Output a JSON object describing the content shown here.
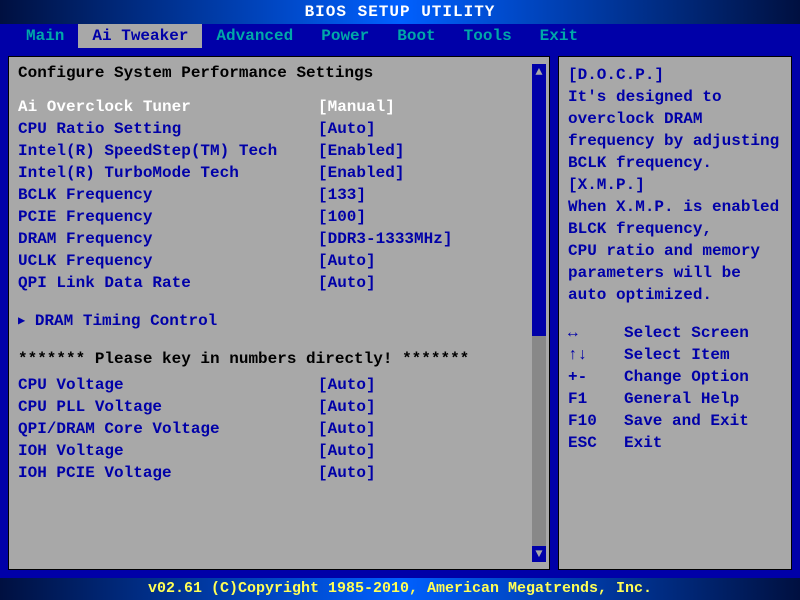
{
  "title": "BIOS SETUP UTILITY",
  "menu": {
    "items": [
      "Main",
      "Ai Tweaker",
      "Advanced",
      "Power",
      "Boot",
      "Tools",
      "Exit"
    ],
    "active_index": 1
  },
  "section_title": "Configure System Performance Settings",
  "settings": [
    {
      "label": "Ai Overclock Tuner",
      "value": "[Manual]",
      "selected": true
    },
    {
      "label": "CPU Ratio Setting",
      "value": "[Auto]"
    },
    {
      "label": "Intel(R) SpeedStep(TM) Tech",
      "value": "[Enabled]"
    },
    {
      "label": "Intel(R) TurboMode Tech",
      "value": "[Enabled]"
    },
    {
      "label": "BCLK Frequency",
      "value": "[133]"
    },
    {
      "label": "PCIE Frequency",
      "value": "[100]"
    },
    {
      "label": "DRAM Frequency",
      "value": "[DDR3-1333MHz]"
    },
    {
      "label": "UCLK Frequency",
      "value": "[Auto]"
    },
    {
      "label": "QPI Link Data Rate",
      "value": "[Auto]"
    }
  ],
  "submenu": {
    "marker": "▶",
    "label": "DRAM Timing Control"
  },
  "note": "******* Please key in numbers directly! *******",
  "settings2": [
    {
      "label": "CPU Voltage",
      "value": "[Auto]"
    },
    {
      "label": "CPU PLL Voltage",
      "value": "[Auto]"
    },
    {
      "label": "QPI/DRAM Core Voltage",
      "value": "[Auto]"
    },
    {
      "label": "IOH Voltage",
      "value": "[Auto]"
    },
    {
      "label": "IOH PCIE Voltage",
      "value": "[Auto]"
    }
  ],
  "help": {
    "lines": [
      "[D.O.C.P.]",
      "It's designed to",
      "overclock DRAM",
      "frequency by adjusting",
      "BCLK frequency.",
      "[X.M.P.]",
      "When X.M.P. is enabled",
      "BLCK frequency,",
      "CPU ratio and memory",
      "parameters will be",
      "auto optimized."
    ]
  },
  "keyhints": [
    {
      "key": "↔",
      "desc": "Select Screen"
    },
    {
      "key": "↑↓",
      "desc": "Select Item"
    },
    {
      "key": "+-",
      "desc": "Change Option"
    },
    {
      "key": "F1",
      "desc": "General Help"
    },
    {
      "key": "F10",
      "desc": "Save and Exit"
    },
    {
      "key": "ESC",
      "desc": "Exit"
    }
  ],
  "footer": "v02.61 (C)Copyright 1985-2010, American Megatrends, Inc.",
  "scroll_arrows": {
    "up": "▲",
    "down": "▼"
  }
}
